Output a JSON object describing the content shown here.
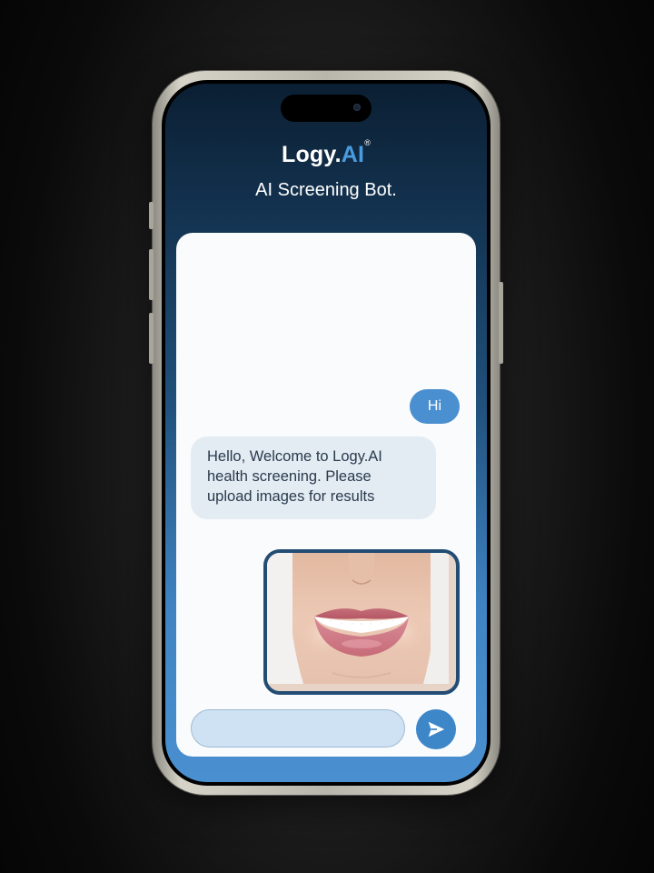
{
  "app": {
    "brand_name": "Logy.",
    "brand_accent": "AI",
    "brand_mark": "®",
    "subtitle": "AI Screening Bot."
  },
  "chat": {
    "messages": [
      {
        "sender": "user",
        "type": "text",
        "text": "Hi"
      },
      {
        "sender": "bot",
        "type": "text",
        "text": "Hello, Welcome to Logy.AI health screening. Please upload images for results"
      },
      {
        "sender": "user",
        "type": "image",
        "image": "smiling-mouth-photo"
      }
    ],
    "input": {
      "value": "",
      "placeholder": ""
    },
    "send_icon": "send-icon"
  },
  "colors": {
    "accent": "#4a8fcf",
    "brand_accent": "#4a9ce0",
    "image_border": "#234c74",
    "bot_bubble": "#e3ebf3"
  }
}
